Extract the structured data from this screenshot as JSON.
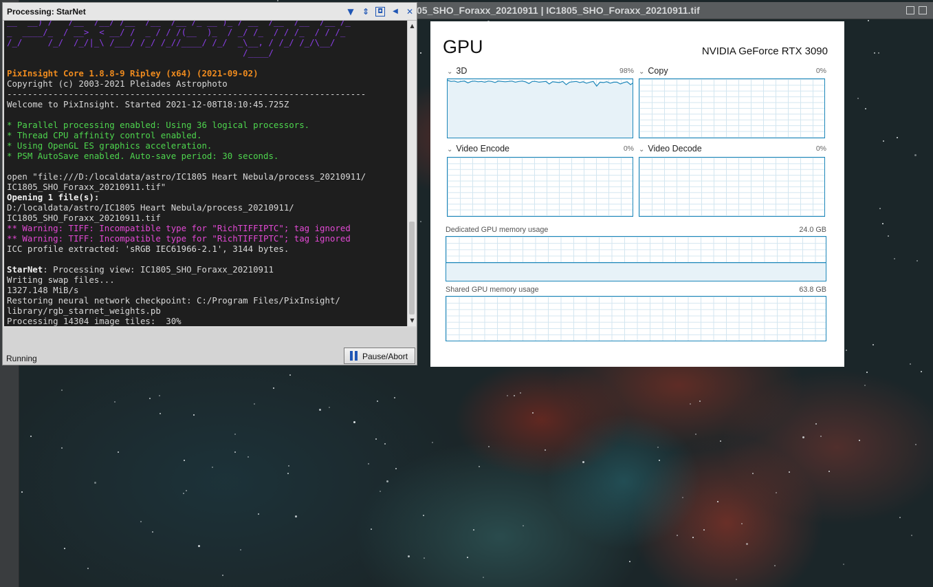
{
  "image_window": {
    "title": "05_SHO_Foraxx_20210911 | IC1805_SHO_Foraxx_20210911.tif"
  },
  "processing_window": {
    "title": "Processing: StarNet",
    "buttons": [
      {
        "name": "shade-down-button",
        "icon": "chevron-down-icon",
        "glyph": "▼"
      },
      {
        "name": "resize-button",
        "icon": "updown-arrows-icon",
        "glyph": "⇕"
      },
      {
        "name": "maximize-button",
        "icon": "square-icon",
        "glyph": "◘"
      },
      {
        "name": "dock-button",
        "icon": "rewind-icon",
        "glyph": "◀"
      },
      {
        "name": "close-button",
        "icon": "close-icon",
        "glyph": "✕"
      }
    ],
    "console_lines": [
      {
        "text": "__  __) /   /__  /__/ /__  /__  /__ /_ __ )_ / __  /__  /__  /__ /_",
        "style": "c-purple"
      },
      {
        "text": "_  ____/_  / __>  < __/ /  _ / / /(__  )_  / _/ /_  / / /_  / / /_",
        "style": "c-purple"
      },
      {
        "text": "/_/     /_/  /_/|_\\ /___/ /_/ /_//____/ /_/  _\\__, / /_/ /_/\\__/",
        "style": "c-purple"
      },
      {
        "text": "                                              /____/",
        "style": "c-purple"
      },
      {
        "text": "",
        "style": ""
      },
      {
        "text": "PixInsight Core 1.8.8-9 Ripley (x64) (2021-09-02)",
        "style": "c-orange"
      },
      {
        "text": "Copyright (c) 2003-2021 Pleiades Astrophoto",
        "style": ""
      },
      {
        "text": "----------------------------------------------------------------------",
        "style": ""
      },
      {
        "text": "Welcome to PixInsight. Started 2021-12-08T18:10:45.725Z",
        "style": ""
      },
      {
        "text": "",
        "style": ""
      },
      {
        "text": "* Parallel processing enabled: Using 36 logical processors.",
        "style": "c-green"
      },
      {
        "text": "* Thread CPU affinity control enabled.",
        "style": "c-green"
      },
      {
        "text": "* Using OpenGL ES graphics acceleration.",
        "style": "c-green"
      },
      {
        "text": "* PSM AutoSave enabled. Auto-save period: 30 seconds.",
        "style": "c-green"
      },
      {
        "text": "",
        "style": ""
      },
      {
        "text": "open \"file:///D:/localdata/astro/IC1805 Heart Nebula/process_20210911/",
        "style": ""
      },
      {
        "text": "IC1805_SHO_Foraxx_20210911.tif\"",
        "style": ""
      },
      {
        "text": "Opening 1 file(s):",
        "style": "c-bold"
      },
      {
        "text": "D:/localdata/astro/IC1805 Heart Nebula/process_20210911/",
        "style": ""
      },
      {
        "text": "IC1805_SHO_Foraxx_20210911.tif",
        "style": ""
      },
      {
        "text": "** Warning: TIFF: Incompatible type for \"RichTIFFIPTC\"; tag ignored",
        "style": "c-magenta"
      },
      {
        "text": "** Warning: TIFF: Incompatible type for \"RichTIFFIPTC\"; tag ignored",
        "style": "c-magenta"
      },
      {
        "text": "ICC profile extracted: 'sRGB IEC61966-2.1', 3144 bytes.",
        "style": ""
      },
      {
        "text": "",
        "style": ""
      },
      {
        "text": "StarNet: Processing view: IC1805_SHO_Foraxx_20210911",
        "style": "mixed-starnet"
      },
      {
        "text": "Writing swap files...",
        "style": ""
      },
      {
        "text": "1327.148 MiB/s",
        "style": ""
      },
      {
        "text": "Restoring neural network checkpoint: C:/Program Files/PixInsight/",
        "style": ""
      },
      {
        "text": "library/rgb_starnet_weights.pb",
        "style": ""
      },
      {
        "text": "Processing 14304 image tiles:  30%",
        "style": ""
      }
    ],
    "status": "Running",
    "pause_label": "Pause/Abort",
    "scrollbar": {
      "up": "▲",
      "down": "▼"
    }
  },
  "gpu": {
    "title": "GPU",
    "model": "NVIDIA GeForce RTX 3090",
    "chevron": "⌄",
    "engines": [
      {
        "label": "3D",
        "percent": "98%",
        "usage": 0.98
      },
      {
        "label": "Copy",
        "percent": "0%",
        "usage": 0
      },
      {
        "label": "Video Encode",
        "percent": "0%",
        "usage": 0
      },
      {
        "label": "Video Decode",
        "percent": "0%",
        "usage": 0
      }
    ],
    "dedicated_memory": {
      "label": "Dedicated GPU memory usage",
      "value": "24.0 GB",
      "usage": 0.43
    },
    "shared_memory": {
      "label": "Shared GPU memory usage",
      "value": "63.8 GB",
      "usage": 0
    }
  },
  "colors": {
    "graph_line": "#1b86b9",
    "graph_fill": "#e7f2f8",
    "console_bg": "#1e1e1e",
    "warning": "#e249d4",
    "info": "#4ed64e",
    "banner": "#8a3ee6",
    "header": "#ef8b1e"
  }
}
